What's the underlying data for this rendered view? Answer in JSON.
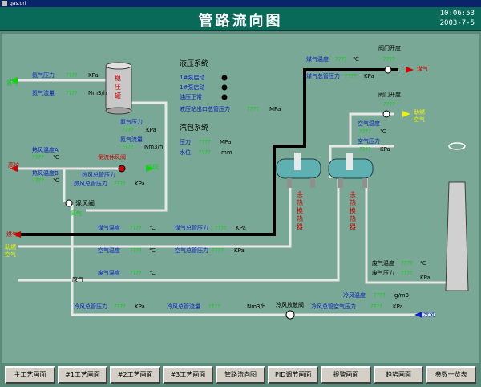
{
  "window": {
    "title": "gas.grf"
  },
  "header": {
    "title": "管路流向图",
    "time": "10:06:53",
    "date": "2003-7-5"
  },
  "gauge_placeholder": "????",
  "labels": {
    "n2_pressure": "氮气压力",
    "n2_pressure_unit": "KPa",
    "n2_flow": "氮气流量",
    "n2_flow_unit": "Nm3/h",
    "n2_inlet": "氮气",
    "tank": "稳压罐",
    "tank_out_pressure": "氮气压力",
    "tank_out_pressure_unit": "KPa",
    "tank_out_flow": "氮气流量",
    "tank_out_flow_unit": "Nm3/h",
    "hyd_system": "液压系统",
    "pump1": "1#泵启动",
    "pump2": "1#泵启动",
    "oil_ok": "油压正常",
    "hyd_out_pressure": "液压站出口总管压力",
    "hyd_out_pressure_unit": "MPa",
    "steam_system": "汽包系统",
    "steam_pressure": "压力",
    "steam_pressure_unit": "MPa",
    "steam_level": "水位",
    "steam_level_unit": "mm",
    "hot_air_temp_a": "热风温度A",
    "hot_air_temp_b": "热风温度B",
    "hot_air_unit": "℃",
    "furnace": "高炉",
    "side_flow_valve": "倒流休风阀",
    "hot_air": "热风",
    "hot_air_total_pressure": "热风总管压力",
    "hot_air_total_pressure_unit": "KPa",
    "mix_valve": "混风阀",
    "mix_n2": "氮气",
    "gas_temp": "煤气温度",
    "gas_temp_unit": "℃",
    "gas_inlet": "煤气",
    "gas_total_pressure": "煤气总管压力",
    "gas_total_pressure_unit": "KPa",
    "air_temp": "空气温度",
    "air_temp_unit": "℃",
    "air_inlet": "助燃空气",
    "air_total_pressure": "空气总管压力",
    "air_total_pressure_unit": "KPa",
    "waste_gas": "废气",
    "waste_temp_left": "废气温度",
    "waste_temp_left_unit": "℃",
    "cold_air_total_pressure": "冷风总管压力",
    "cold_air_total_pressure_unit": "KPa",
    "cold_air_total_flow": "冷风总管流量",
    "cold_air_total_flow_unit": "Nm3/h",
    "cold_air_release_valve": "冷风放散阀",
    "cold_air_temp": "冷风温度",
    "cold_air_temp_unit": "g/m3",
    "cold_air_total_air_pressure": "冷风总管空气压力",
    "cold_air_total_air_pressure_unit": "KPa",
    "cold_air_inlet": "冷风",
    "top_gas_temp": "煤气温度",
    "top_gas_temp_unit": "℃",
    "top_gas_pressure": "煤气总管压力",
    "top_gas_pressure_unit": "KPa",
    "valve_opening_1": "阀门开度",
    "gas_inlet_right": "煤气",
    "valve_opening_2": "阀门开度",
    "air_inlet_right": "助燃空气",
    "air_temp_right": "空气温度",
    "air_temp_right_unit": "℃",
    "air_pressure_right": "空气压力",
    "air_pressure_right_unit": "KPa",
    "heat_exchanger_1": "余热换热器",
    "heat_exchanger_2": "余热换热器",
    "waste_temp_right": "废气温度",
    "waste_temp_right_unit": "℃",
    "waste_pressure_right": "废气压力",
    "waste_pressure_right_unit": "KPa"
  },
  "nav": [
    "主工艺画面",
    "#1工艺画面",
    "#2工艺画面",
    "#3工艺画面",
    "管路流向图",
    "PID调节画面",
    "报警画面",
    "趋势画面",
    "参数一览表"
  ]
}
